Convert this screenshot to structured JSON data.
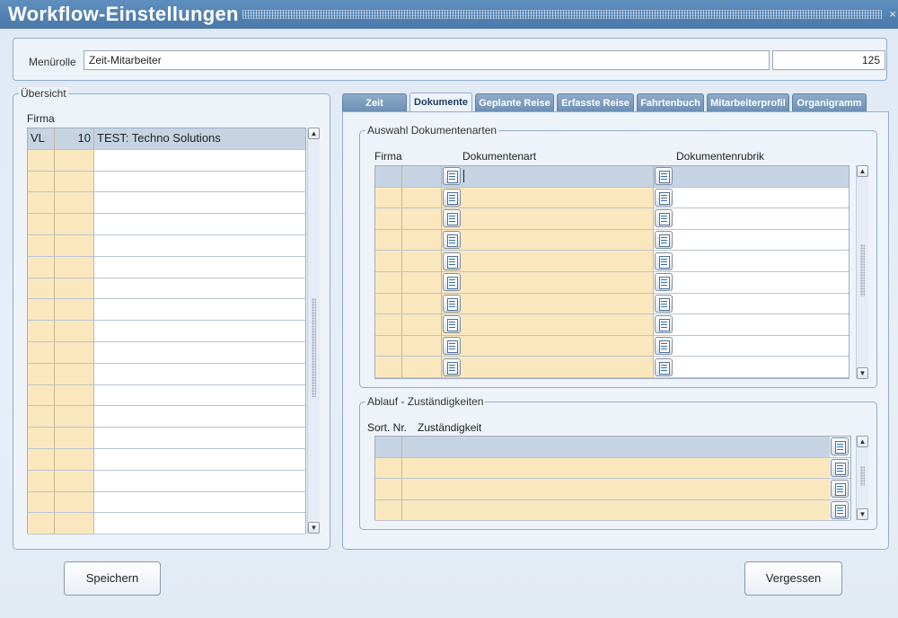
{
  "window": {
    "title": "Workflow-Einstellungen",
    "close_glyph": "×"
  },
  "menu_role": {
    "label": "Menürolle",
    "value": "Zeit-Mitarbeiter",
    "number": "125"
  },
  "overview": {
    "legend": "Übersicht",
    "column_label": "Firma",
    "rows": [
      {
        "vl": "VL",
        "nr": "10",
        "name": "TEST: Techno Solutions"
      }
    ],
    "empty_rows": 18
  },
  "tabs": [
    {
      "label": "Zeit",
      "active": false
    },
    {
      "label": "Dokumente",
      "active": true
    },
    {
      "label": "Geplante Reise",
      "active": false
    },
    {
      "label": "Erfasste Reise",
      "active": false
    },
    {
      "label": "Fahrtenbuch",
      "active": false
    },
    {
      "label": "Mitarbeiterprofil",
      "active": false
    },
    {
      "label": "Organigramm",
      "active": false
    }
  ],
  "documents": {
    "legend": "Auswahl Dokumentenarten",
    "col_firma": "Firma",
    "col_dokumentenart": "Dokumentenart",
    "col_dokumentenrubrik": "Dokumentenrubrik",
    "row_count": 10
  },
  "responsibilities": {
    "legend": "Ablauf - Zuständigkeiten",
    "col_sort": "Sort. Nr.",
    "col_zustaendigkeit": "Zuständigkeit",
    "row_count": 4
  },
  "buttons": {
    "save": "Speichern",
    "forget": "Vergessen"
  },
  "colors": {
    "titlebar": "#4a78a8",
    "header_cell": "#c5d3e3",
    "input_cell": "#fbe7be",
    "tab": "#7a9bbf"
  }
}
